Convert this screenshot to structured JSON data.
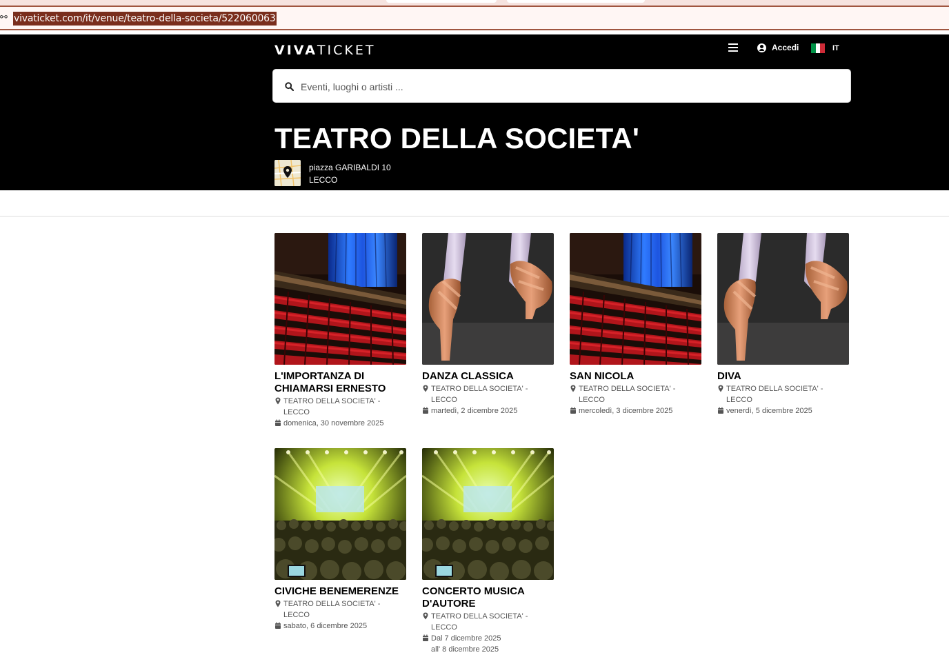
{
  "browser": {
    "url": "vivaticket.com/it/venue/teatro-della-societa/522060063",
    "site_icon": "site-info-icon"
  },
  "header": {
    "logo_bold": "VIVA",
    "logo_light": "TICKET",
    "login_label": "Accedi",
    "language": "IT",
    "flag_colors": [
      "#009246",
      "#ffffff",
      "#ce2b37"
    ]
  },
  "search": {
    "placeholder": "Eventi, luoghi o artisti ..."
  },
  "venue": {
    "name": "TEATRO DELLA SOCIETA'",
    "address_line1": "piazza GARIBALDI 10",
    "address_line2": "LECCO"
  },
  "events": [
    {
      "title": "L'IMPORTANZA DI CHIAMARSI ERNESTO",
      "venue": "TEATRO DELLA SOCIETA' - LECCO",
      "date": "domenica, 30 novembre 2025",
      "image": "theater"
    },
    {
      "title": "DANZA CLASSICA",
      "venue": "TEATRO DELLA SOCIETA' - LECCO",
      "date": "martedì, 2 dicembre 2025",
      "image": "ballet"
    },
    {
      "title": "SAN NICOLA",
      "venue": "TEATRO DELLA SOCIETA' - LECCO",
      "date": "mercoledì, 3 dicembre 2025",
      "image": "theater"
    },
    {
      "title": "DIVA",
      "venue": "TEATRO DELLA SOCIETA' - LECCO",
      "date": "venerdì, 5 dicembre 2025",
      "image": "ballet"
    },
    {
      "title": "CIVICHE BENEMERENZE",
      "venue": "TEATRO DELLA SOCIETA' - LECCO",
      "date": "sabato, 6 dicembre 2025",
      "image": "concert"
    },
    {
      "title": "CONCERTO MUSICA D'AUTORE",
      "venue": "TEATRO DELLA SOCIETA' - LECCO",
      "date": "Dal 7 dicembre 2025",
      "date2": "all' 8 dicembre 2025",
      "image": "concert"
    }
  ]
}
